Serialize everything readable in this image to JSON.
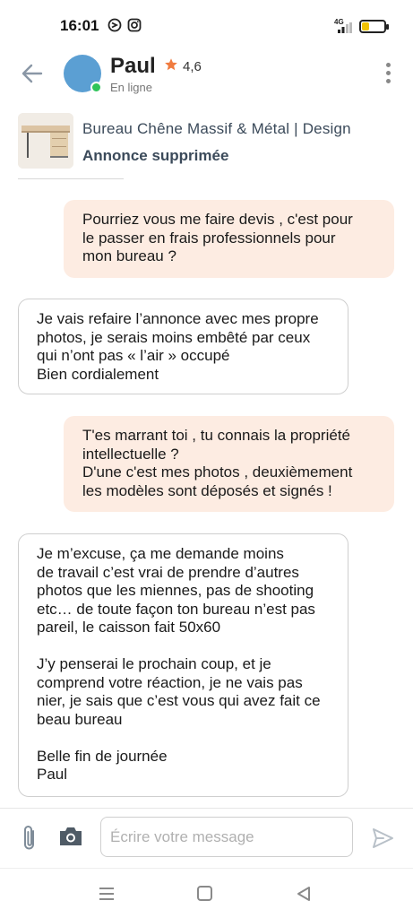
{
  "status_bar": {
    "time": "16:01",
    "network": "4G",
    "battery_level": 0.35
  },
  "header": {
    "name": "Paul",
    "rating": "4,6",
    "presence": "En ligne",
    "colors": {
      "avatar": "#5b9fd3",
      "online": "#2fc45a",
      "star": "#f07b3f"
    }
  },
  "listing": {
    "title": "Bureau Chêne Massif & Métal | Design",
    "status": "Annonce supprimée"
  },
  "messages": [
    {
      "direction": "outgoing",
      "text": "Pourriez vous me faire devis , c'est pour\nle passer en frais professionnels pour\nmon bureau ?"
    },
    {
      "direction": "incoming",
      "text": "Je vais refaire l’annonce avec mes propre\nphotos, je serais moins embêté par ceux\nqui n’ont pas « l’air » occupé\nBien cordialement"
    },
    {
      "direction": "outgoing",
      "text": "T'es marrant toi , tu connais la propriété\nintellectuelle ?\nD'une c'est mes photos , deuxièmement\nles modèles sont déposés et signés !"
    },
    {
      "direction": "incoming",
      "text": "Je m’excuse, ça me demande moins\nde travail c’est vrai de prendre d’autres\nphotos que les miennes, pas de shooting\netc… de toute façon ton bureau n’est pas\npareil, le caisson fait 50x60\n\nJ’y penserai le prochain coup, et je\ncomprend votre réaction, je ne vais pas\nnier, je sais que c’est vous qui avez fait ce\nbeau bureau\n\nBelle fin de journée\nPaul"
    }
  ],
  "composer": {
    "placeholder": "Écrire votre message",
    "value": ""
  },
  "icons": {
    "back": "arrow-left-icon",
    "menu": "more-vertical-icon",
    "attach": "paperclip-icon",
    "camera": "camera-icon",
    "send": "send-icon"
  },
  "colors": {
    "outgoing_bubble": "#fdece2",
    "incoming_border": "#cfcfcf",
    "listing_text": "#3b4a5a"
  }
}
